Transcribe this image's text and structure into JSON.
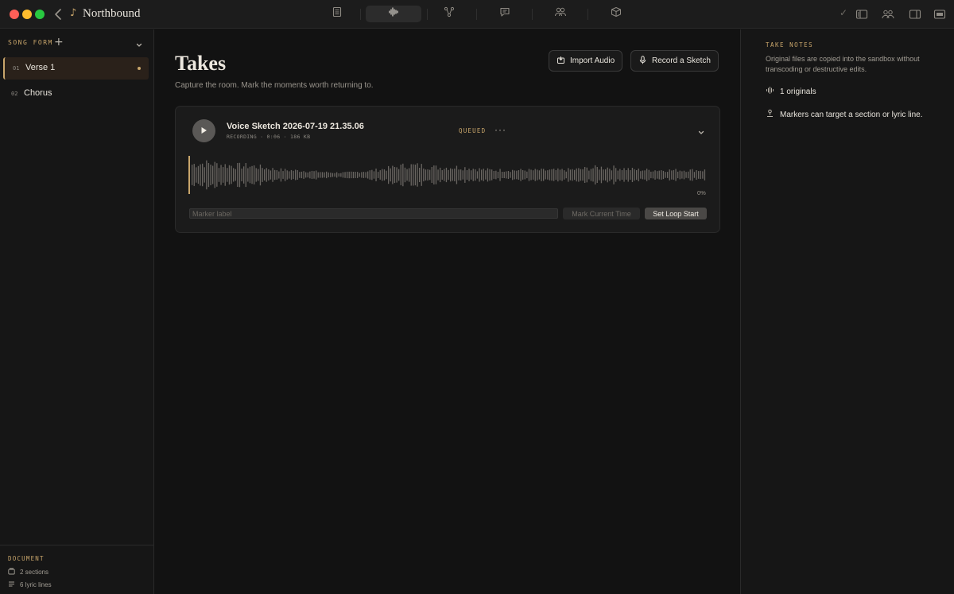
{
  "window": {
    "title": "Northbound"
  },
  "toolbar": {
    "tabs": [
      {
        "name": "lyrics",
        "icon": "document-icon",
        "active": false
      },
      {
        "name": "takes",
        "icon": "waveform-icon",
        "active": true
      },
      {
        "name": "structure",
        "icon": "nodes-icon",
        "active": false
      },
      {
        "name": "comments",
        "icon": "comment-icon",
        "active": false
      },
      {
        "name": "collaborators",
        "icon": "people-icon",
        "active": false
      },
      {
        "name": "export",
        "icon": "box-icon",
        "active": false
      }
    ],
    "right_tools": [
      "checkmark-icon",
      "sidebar-left-icon",
      "people-icon",
      "sidebar-right-icon",
      "panel-icon"
    ]
  },
  "sidebar": {
    "heading": "SONG FORM",
    "sections": [
      {
        "number": "01",
        "label": "Verse 1",
        "active": true
      },
      {
        "number": "02",
        "label": "Chorus",
        "active": false
      }
    ],
    "footer": {
      "heading": "DOCUMENT",
      "sections_count": "2 sections",
      "lyric_lines": "6 lyric lines"
    }
  },
  "main": {
    "title": "Takes",
    "subtitle": "Capture the room. Mark the moments worth returning to.",
    "import_label": "Import Audio",
    "record_label": "Record a Sketch",
    "take": {
      "title": "Voice Sketch 2026-07-19 21.35.06",
      "meta": "RECORDING · 0:06 · 186 KB",
      "status": "QUEUED",
      "more": "···",
      "progress": "0%",
      "progress_value": 0,
      "marker_placeholder": "Marker label",
      "mark_current_time": "Mark Current Time",
      "set_loop_start": "Set Loop Start"
    }
  },
  "right_panel": {
    "heading": "TAKE NOTES",
    "description": "Original files are copied into the sandbox without transcoding or destructive edits.",
    "originals": "1 originals",
    "markers_note": "Markers can target a section or lyric line."
  },
  "colors": {
    "accent": "#c9a66b",
    "background": "#131313",
    "panel": "#161616",
    "card": "#1b1b1b",
    "waveform": "#6a6662"
  }
}
